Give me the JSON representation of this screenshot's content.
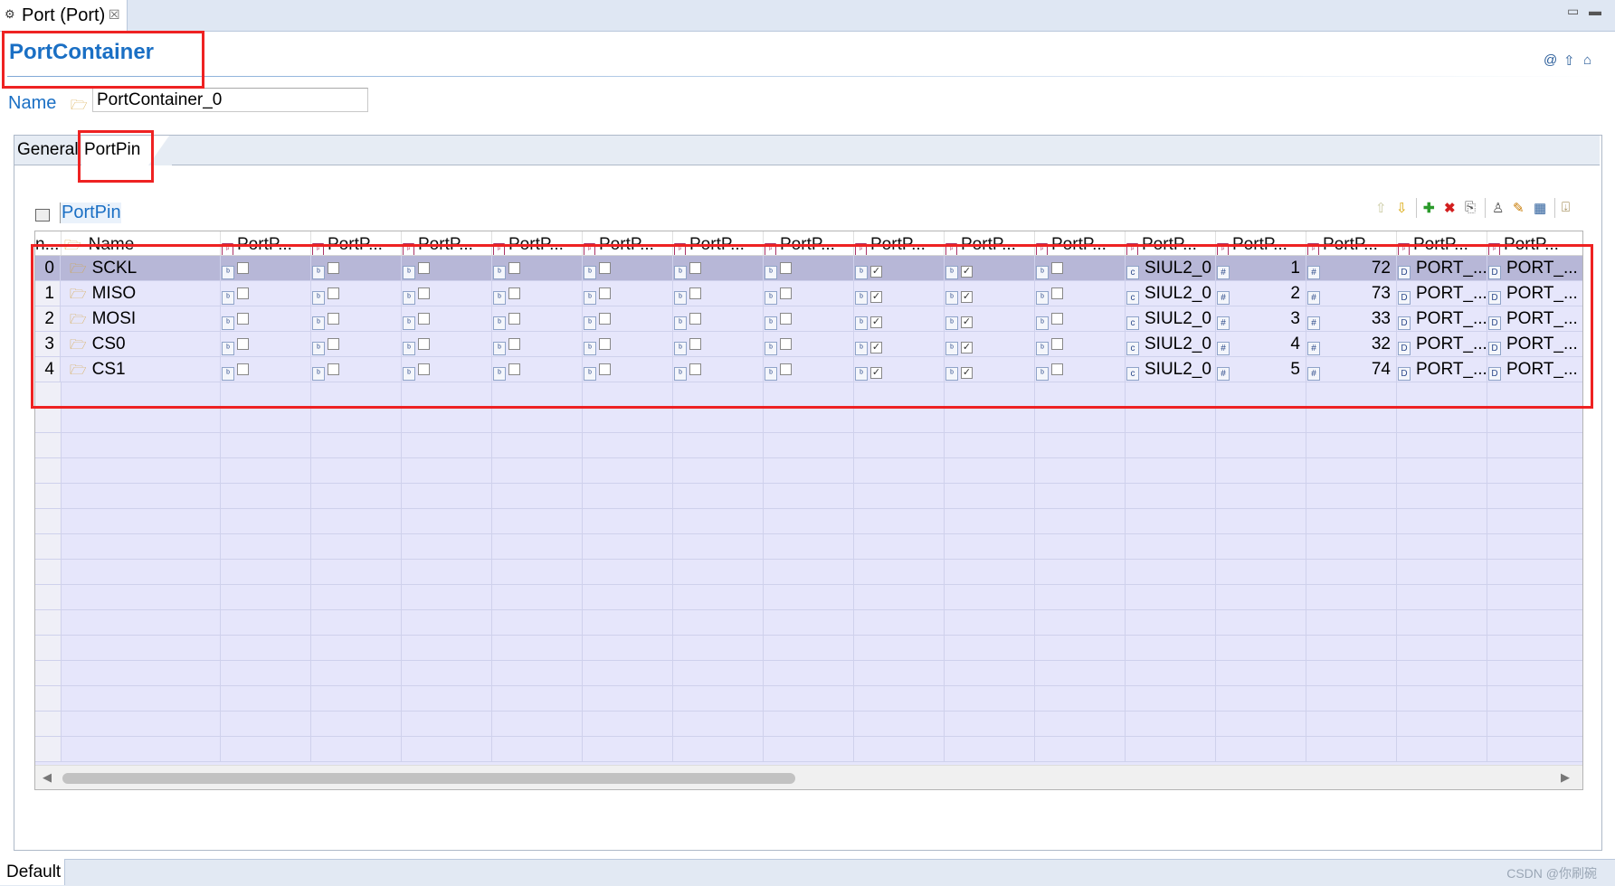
{
  "editor_tab": {
    "title": "Port (Port)",
    "close": "☒"
  },
  "window_controls": {
    "minimize": "▭",
    "maximize": "▬"
  },
  "header": {
    "title": "PortContainer",
    "icons": [
      "at-icon",
      "up-arrow-icon",
      "home-icon"
    ]
  },
  "name_field": {
    "label": "Name",
    "value": "PortContainer_0"
  },
  "tabs": [
    {
      "label": "General"
    },
    {
      "label": "PortPin"
    }
  ],
  "section": {
    "title": "PortPin"
  },
  "table": {
    "columns": [
      "n...",
      "Name",
      "PortP...",
      "PortP...",
      "PortP...",
      "PortP...",
      "PortP...",
      "PortP...",
      "PortP...",
      "PortP...",
      "PortP...",
      "PortP...",
      "PortP...",
      "PortP...",
      "PortP...",
      "PortP...",
      "PortP..."
    ],
    "rows": [
      {
        "idx": "0",
        "name": "SCKL",
        "checks": [
          false,
          false,
          false,
          false,
          false,
          false,
          false,
          true,
          true,
          false
        ],
        "mode": "SIUL2_0",
        "id": "1",
        "pin": "72",
        "a": "PORT_...",
        "b": "PORT_..."
      },
      {
        "idx": "1",
        "name": "MISO",
        "checks": [
          false,
          false,
          false,
          false,
          false,
          false,
          false,
          true,
          true,
          false
        ],
        "mode": "SIUL2_0",
        "id": "2",
        "pin": "73",
        "a": "PORT_...",
        "b": "PORT_..."
      },
      {
        "idx": "2",
        "name": "MOSI",
        "checks": [
          false,
          false,
          false,
          false,
          false,
          false,
          false,
          true,
          true,
          false
        ],
        "mode": "SIUL2_0",
        "id": "3",
        "pin": "33",
        "a": "PORT_...",
        "b": "PORT_..."
      },
      {
        "idx": "3",
        "name": "CS0",
        "checks": [
          false,
          false,
          false,
          false,
          false,
          false,
          false,
          true,
          true,
          false
        ],
        "mode": "SIUL2_0",
        "id": "4",
        "pin": "32",
        "a": "PORT_...",
        "b": "PORT_..."
      },
      {
        "idx": "4",
        "name": "CS1",
        "checks": [
          false,
          false,
          false,
          false,
          false,
          false,
          false,
          true,
          true,
          false
        ],
        "mode": "SIUL2_0",
        "id": "5",
        "pin": "74",
        "a": "PORT_...",
        "b": "PORT_..."
      }
    ]
  },
  "bottom_tab": {
    "label": "Default"
  },
  "watermark": "CSDN @你刷碗",
  "colors": {
    "accent": "#1a6fc4",
    "row_bg": "#e6e6fb",
    "row_selected": "#b7b7d7",
    "annotation": "#ee2222"
  }
}
